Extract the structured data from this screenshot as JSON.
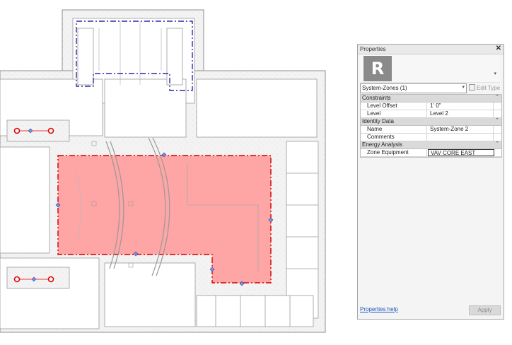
{
  "panel": {
    "title": "Properties",
    "close_glyph": "✕",
    "logo_letter": "R",
    "preview_dropdown_glyph": "▾",
    "type_selector": "System-Zones (1)",
    "type_selector_arrow": "▾",
    "edit_type_label": "Edit Type",
    "collapse_glyph": "⌃",
    "groups": [
      {
        "label": "Constraints",
        "rows": [
          {
            "name": "Level Offset",
            "value": "1'  0\""
          },
          {
            "name": "Level",
            "value": "Level 2"
          }
        ]
      },
      {
        "label": "Identity Data",
        "rows": [
          {
            "name": "Name",
            "value": "System-Zone 2"
          },
          {
            "name": "Comments",
            "value": ""
          }
        ]
      },
      {
        "label": "Energy Analysis",
        "rows": [
          {
            "name": "Zone Equipment",
            "value": "VAV CORE EAST"
          }
        ]
      }
    ],
    "help_link": "Properties help",
    "apply_label": "Apply"
  },
  "colors": {
    "zone_fill": "#ff9c9c",
    "zone_outline": "#d40000",
    "zone_boundary_blue": "#2a2aa8",
    "wall_fill": "#f1f1f1",
    "wall_stroke": "#8c8c8c",
    "grille_red": "#e60000"
  },
  "icons": {
    "close": "close-icon",
    "logo": "revit-logo-icon",
    "edit_type": "edit-type-icon",
    "collapse": "chevron-up-icon"
  }
}
